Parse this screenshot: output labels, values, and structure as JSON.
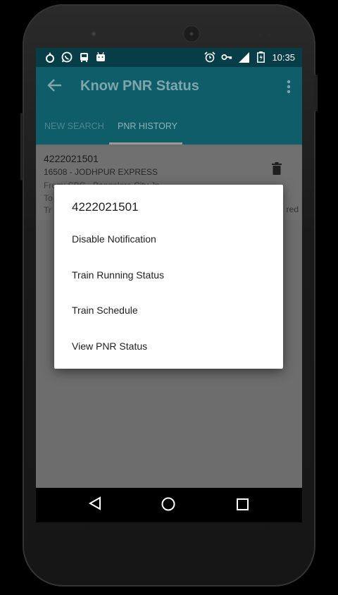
{
  "status_bar": {
    "time": "10:35",
    "left_icons": [
      "app-flame-icon",
      "whatsapp-icon",
      "train-icon",
      "android-icon"
    ],
    "right_icons": [
      "alarm-icon",
      "key-icon",
      "signal-icon",
      "battery-icon"
    ]
  },
  "app_bar": {
    "title": "Know PNR Status",
    "back_icon": "arrow-back-icon",
    "menu_icon": "more-vert-icon"
  },
  "tabs": [
    {
      "label": "NEW SEARCH",
      "active": false
    },
    {
      "label": "PNR HISTORY",
      "active": true
    }
  ],
  "history_card": {
    "pnr": "4222021501",
    "train": "16508 - JODHPUR EXPRESS",
    "from": "From: SBC - Bangalore City Jn",
    "line4": "To",
    "line5": "Tr",
    "status_tail": "red"
  },
  "dialog": {
    "title": "4222021501",
    "items": [
      "Disable Notification",
      "Train Running Status",
      "Train Schedule",
      "View PNR Status"
    ]
  },
  "colors": {
    "status_bar": "#073d46",
    "app_bar": "#0e5d69",
    "scrim_background": "#6d6d6d",
    "dialog": "#ffffff"
  }
}
